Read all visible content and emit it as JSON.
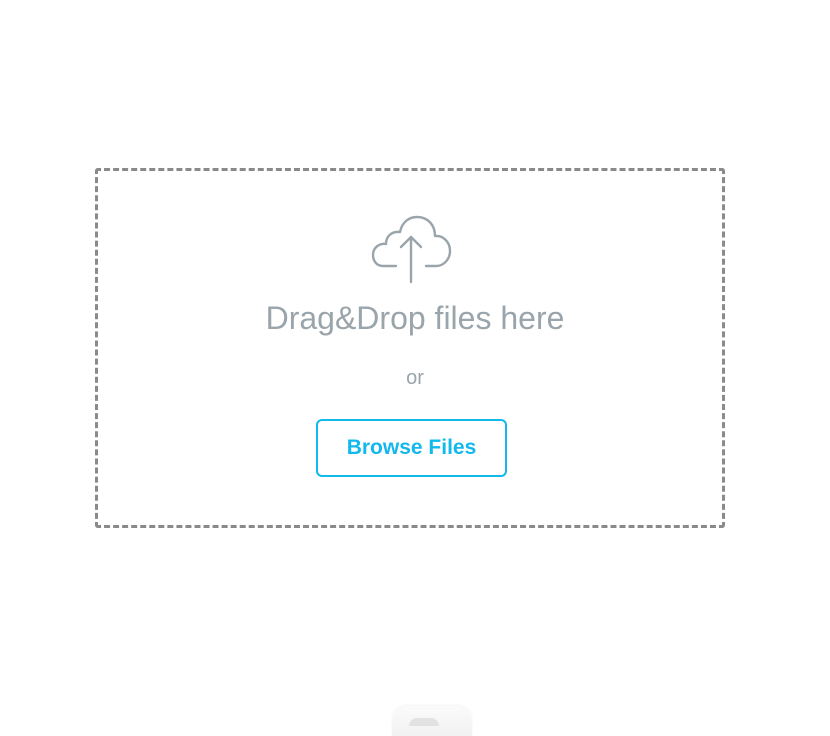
{
  "dropzone": {
    "icon": "cloud-upload-icon",
    "title": "Drag&Drop files here",
    "separator": "or",
    "browse_label": "Browse Files"
  },
  "colors": {
    "accent": "#13b8ec",
    "muted_text": "#9aa4ab",
    "border": "#8a8a8a"
  }
}
